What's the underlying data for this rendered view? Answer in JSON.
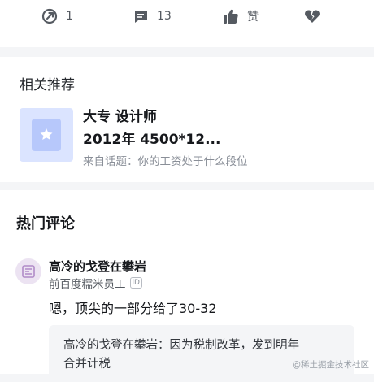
{
  "actions": {
    "share_count": "1",
    "comment_count": "13",
    "like_label": "赞"
  },
  "related": {
    "title": "相关推荐",
    "item": {
      "title_line1": "大专 设计师",
      "title_line2": "2012年 4500*12...",
      "source": "来自话题：你的工资处于什么段位"
    }
  },
  "hot_comments": {
    "title": "热门评论",
    "comment": {
      "author": "高冷的戈登在攀岩",
      "role": "前百度糯米员工",
      "badge": "iD",
      "text": "嗯，顶尖的一部分给了30-32",
      "reply_line1": "高冷的戈登在攀岩：因为税制改革，发到明年",
      "reply_line2": "合并计税"
    }
  },
  "watermark": "@稀土掘金技术社区",
  "icons": [
    "share-icon",
    "comment-icon",
    "thumbs-up-icon",
    "heart-broken-icon",
    "star-doc-icon",
    "avatar-icon"
  ],
  "colors": {
    "icon": "#555a61",
    "thumb_bg": "#dbe4ff",
    "thumb_doc": "#b7c8fb",
    "muted": "#8a8f98"
  }
}
